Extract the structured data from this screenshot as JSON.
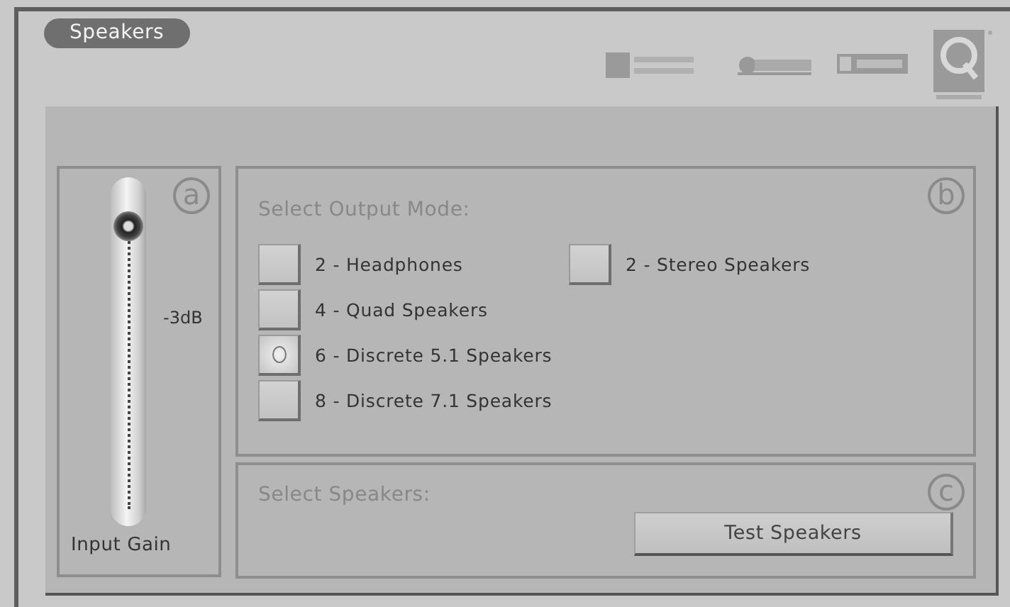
{
  "tab": {
    "label": "Speakers",
    "selected": true
  },
  "gain": {
    "marker": "a",
    "level": 0.9,
    "reading": "-3dB",
    "label": "Input Gain"
  },
  "output_mode": {
    "marker": "b",
    "heading": "Select Output Mode:",
    "rows": [
      [
        {
          "label": "2 - Headphones",
          "selected": false
        },
        {
          "label": "2 - Stereo Speakers",
          "selected": false
        }
      ],
      [
        {
          "label": "4 - Quad Speakers",
          "selected": false
        }
      ],
      [
        {
          "label": "6 - Discrete 5.1 Speakers",
          "selected": true
        }
      ],
      [
        {
          "label": "8 - Discrete 7.1 Speakers",
          "selected": false
        }
      ]
    ]
  },
  "speakers": {
    "marker": "c",
    "heading": "Select Speakers:",
    "button": "Test Speakers"
  }
}
